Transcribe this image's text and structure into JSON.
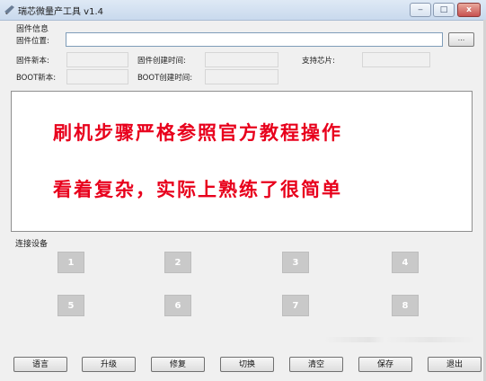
{
  "window": {
    "title": "瑞芯微量产工具 v1.4",
    "min_label": "‒",
    "max_label": "□",
    "close_label": "x"
  },
  "firmware": {
    "group_title": "固件信息",
    "location_label": "固件位置:",
    "location_value": "",
    "browse_label": "...",
    "version_label": "固件新本:",
    "version_value": "",
    "created_label": "固件创建时间:",
    "created_value": "",
    "chip_label": "支持芯片:",
    "chip_value": "",
    "boot_version_label": "BOOT新本:",
    "boot_version_value": "",
    "boot_created_label": "BOOT创建时间:",
    "boot_created_value": ""
  },
  "log": {
    "line1": "刷机步骤严格参照官方教程操作",
    "line2": "看着复杂，实际上熟练了很简单",
    "text_color": "#e8001c"
  },
  "devices": {
    "group_title": "连接设备",
    "slots": [
      "1",
      "2",
      "3",
      "4",
      "5",
      "6",
      "7",
      "8"
    ]
  },
  "buttons": {
    "language": "语言",
    "upgrade": "升级",
    "repair": "修复",
    "switch": "切换",
    "clear": "清空",
    "save": "保存",
    "exit": "退出"
  }
}
